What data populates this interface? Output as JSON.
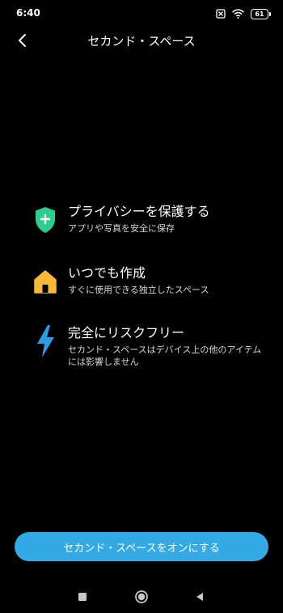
{
  "status_bar": {
    "time": "6:40",
    "battery": "61",
    "icons": [
      "sim-off-icon",
      "wifi-icon",
      "battery-icon"
    ]
  },
  "header": {
    "title": "セカンド・スペース",
    "back_icon": "chevron-left-icon"
  },
  "features": [
    {
      "icon": "shield-plus-icon",
      "icon_color": "#2ecc8f",
      "title": "プライバシーを保護する",
      "description": "アプリや写真を安全に保存"
    },
    {
      "icon": "home-icon",
      "icon_color": "#f9b93a",
      "title": "いつでも作成",
      "description": "すぐに使用できる独立したスペース"
    },
    {
      "icon": "lightning-icon",
      "icon_color": "#2e9be6",
      "title": "完全にリスクフリー",
      "description": "セカンド・スペースはデバイス上の他のアイテムには影響しません"
    }
  ],
  "cta": {
    "label": "セカンド・スペースをオンにする",
    "color": "#34a9e4"
  },
  "nav_bar": {
    "icons": [
      "recent-apps-icon",
      "home-button-icon",
      "back-triangle-icon"
    ]
  }
}
